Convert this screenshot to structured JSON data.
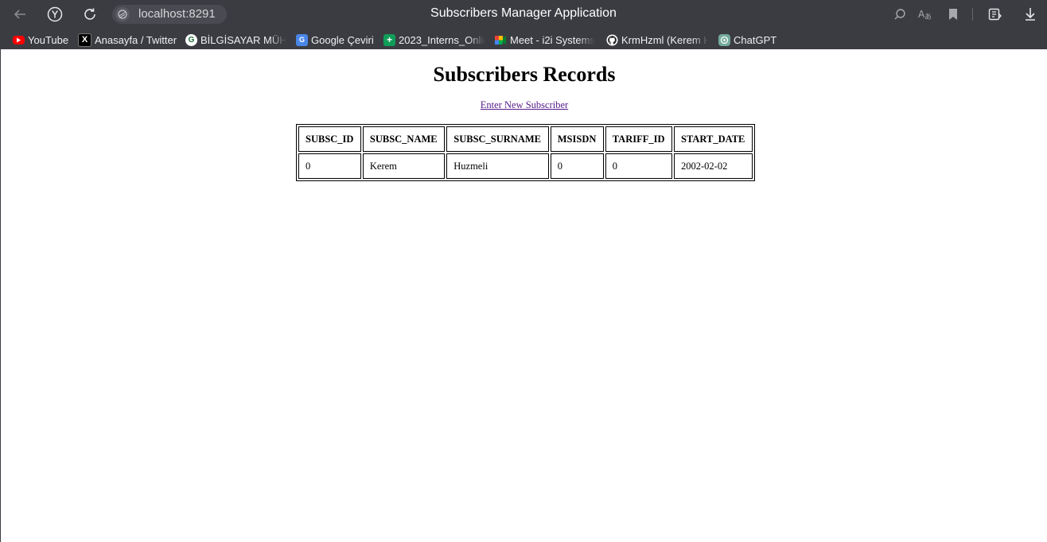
{
  "browser": {
    "url": "localhost:8291",
    "window_title": "Subscribers Manager Application",
    "toolbar_icons": [
      "back-icon",
      "yandex-icon",
      "reload-icon",
      "site-info-icon",
      "page-search-icon",
      "translate-icon",
      "bookmark-icon",
      "collections-icon",
      "download-icon"
    ],
    "bookmarks": [
      {
        "label": "YouTube",
        "icon": "youtube-icon"
      },
      {
        "label": "Anasayfa / Twitter",
        "icon": "x-icon"
      },
      {
        "label": "BİLGİSAYAR MÜHE",
        "icon": "site-icon"
      },
      {
        "label": "Google Çeviri",
        "icon": "google-translate-icon"
      },
      {
        "label": "2023_Interns_Onlir",
        "icon": "sheets-icon"
      },
      {
        "label": "Meet - i2i Systems",
        "icon": "meet-icon"
      },
      {
        "label": "KrmHzml (Kerem H",
        "icon": "github-icon"
      },
      {
        "label": "ChatGPT",
        "icon": "chatgpt-icon"
      }
    ]
  },
  "page": {
    "heading": "Subscribers Records",
    "new_subscriber_link": "Enter New Subscriber",
    "table": {
      "columns": [
        "SUBSC_ID",
        "SUBSC_NAME",
        "SUBSC_SURNAME",
        "MSISDN",
        "TARIFF_ID",
        "START_DATE"
      ],
      "rows": [
        [
          "0",
          "Kerem",
          "Huzmeli",
          "0",
          "0",
          "2002-02-02"
        ]
      ]
    }
  },
  "colors": {
    "chrome_bg": "#3b3c42",
    "link_visited": "#551a8b"
  }
}
